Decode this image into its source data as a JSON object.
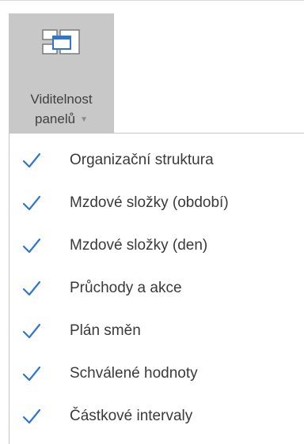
{
  "ribbon": {
    "button": {
      "label_line1": "Viditelnost",
      "label_line2": "panelů",
      "icon": "panels-visibility-icon",
      "caret_icon": "dropdown-caret-icon"
    }
  },
  "menu": {
    "check_icon": "checkmark-icon",
    "check_color": "#2e75d6",
    "items": [
      {
        "label": "Organizační struktura",
        "checked": true
      },
      {
        "label": "Mzdové složky (období)",
        "checked": true
      },
      {
        "label": "Mzdové složky (den)",
        "checked": true
      },
      {
        "label": "Průchody a akce",
        "checked": true
      },
      {
        "label": "Plán směn",
        "checked": true
      },
      {
        "label": "Schválené hodnoty",
        "checked": true
      },
      {
        "label": "Částkové intervaly",
        "checked": true
      }
    ]
  }
}
